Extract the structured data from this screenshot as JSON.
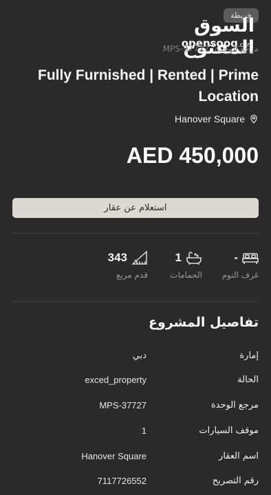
{
  "header": {
    "map_button": "خريطة",
    "logo_arabic": "السوق المفتوح",
    "logo_english": "opensooq",
    "logo_domain": ".com",
    "reference_line": "مرجع الوحدة: MPS-37727"
  },
  "listing": {
    "title": "Fully Furnished | Rented | Prime Location",
    "location": "Hanover Square",
    "price": "AED 450,000",
    "inquire_button": "استعلام عن عقار"
  },
  "stats": {
    "bedrooms": {
      "value": "-",
      "label": "غرف النوم",
      "icon": "bed-icon"
    },
    "bathrooms": {
      "value": "1",
      "label": "الحمامات",
      "icon": "bathtub-icon"
    },
    "area": {
      "value": "343",
      "label": "قدم مربع",
      "icon": "area-icon"
    }
  },
  "project_details": {
    "title": "تفاصيل المشروع",
    "rows": [
      {
        "key": "إمارة",
        "value": "دبي"
      },
      {
        "key": "الحالة",
        "value": "exced_property"
      },
      {
        "key": "مرجع الوحدة",
        "value": "MPS-37727"
      },
      {
        "key": "موقف السيارات",
        "value": "1"
      },
      {
        "key": "اسم العقار",
        "value": "Hanover Square"
      },
      {
        "key": "رقم التصريح",
        "value": "7117726552"
      }
    ]
  },
  "colors": {
    "background": "#2a2a2a",
    "button_bg": "#dcd8d2",
    "muted_text": "#9a9a9a"
  }
}
